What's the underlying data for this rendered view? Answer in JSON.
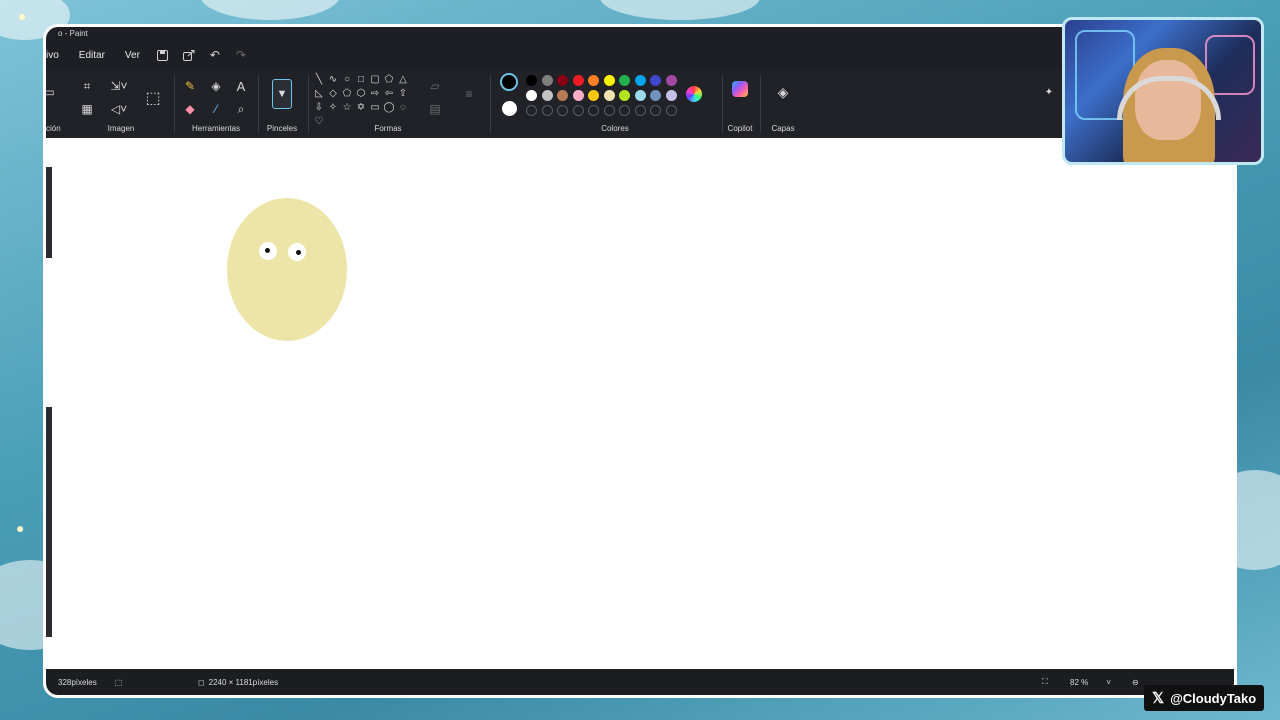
{
  "window": {
    "title": "o - Paint"
  },
  "menu": {
    "file_partial": "ivo",
    "edit": "Editar",
    "view": "Ver"
  },
  "ribbon": {
    "side_partial": "ción",
    "groups": {
      "image": "Imagen",
      "tools": "Herramientas",
      "brushes": "Pinceles",
      "shapes": "Formas",
      "colors": "Colores",
      "copilot": "Copilot",
      "layers": "Capas"
    },
    "palette_row1": [
      "#000000",
      "#7f7f7f",
      "#880015",
      "#ed1c24",
      "#ff7f27",
      "#fff200",
      "#22b14c",
      "#00a2e8",
      "#3f48cc",
      "#a349a4"
    ],
    "palette_row2": [
      "#ffffff",
      "#c3c3c3",
      "#b97a57",
      "#ffaec9",
      "#ffc90e",
      "#efe4b0",
      "#b5e61d",
      "#99d9ea",
      "#7092be",
      "#c8bfe7"
    ],
    "primary_color": "#000000",
    "secondary_color": "#ffffff"
  },
  "canvas": {
    "egg_color": "#ede4a8"
  },
  "status": {
    "position_partial": "328píxeles",
    "canvas_size": "2240 × 1181píxeles",
    "zoom": "82 %"
  },
  "overlay": {
    "handle": "@CloudyTako"
  }
}
